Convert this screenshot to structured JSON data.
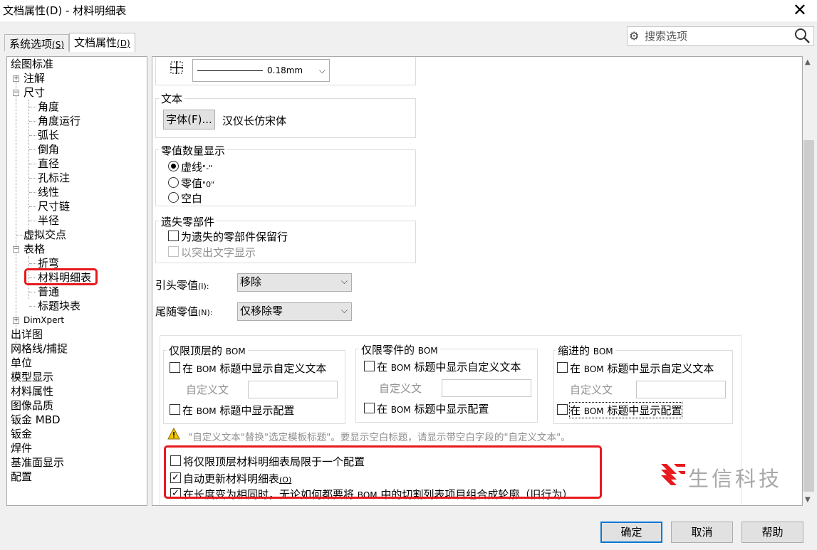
{
  "window": {
    "title": "文档属性(D) - 材料明细表",
    "close": "✕"
  },
  "tabs": [
    {
      "label": "系统选项",
      "accel": "(S)"
    },
    {
      "label": "文档属性",
      "accel": "(D)"
    }
  ],
  "search": {
    "placeholder": "搜索选项"
  },
  "tree": {
    "items": [
      {
        "label": "绘图标准"
      },
      {
        "label": "注解",
        "expander": "+"
      },
      {
        "label": "尺寸",
        "expander": "−"
      },
      {
        "label": "角度"
      },
      {
        "label": "角度运行"
      },
      {
        "label": "弧长"
      },
      {
        "label": "倒角"
      },
      {
        "label": "直径"
      },
      {
        "label": "孔标注"
      },
      {
        "label": "线性"
      },
      {
        "label": "尺寸链"
      },
      {
        "label": "半径"
      },
      {
        "label": "虚拟交点"
      },
      {
        "label": "表格",
        "expander": "−"
      },
      {
        "label": "折弯"
      },
      {
        "label": "材料明细表",
        "selected": true
      },
      {
        "label": "普通"
      },
      {
        "label": "标题块表"
      },
      {
        "label": "DimXpert",
        "expander": "+"
      },
      {
        "label": "出详图"
      },
      {
        "label": "网格线/捕捉"
      },
      {
        "label": "单位"
      },
      {
        "label": "模型显示"
      },
      {
        "label": "材料属性"
      },
      {
        "label": "图像品质"
      },
      {
        "label": "钣金 MBD"
      },
      {
        "label": "钣金"
      },
      {
        "label": "焊件"
      },
      {
        "label": "基准面显示"
      },
      {
        "label": "配置"
      }
    ]
  },
  "border": {
    "thickness": "0.18mm"
  },
  "text_group": {
    "title": "文本",
    "font_button": "字体(F)...",
    "font_name": "汉仪长仿宋体"
  },
  "zero_group": {
    "title": "零值数量显示",
    "options": [
      {
        "label": "虚线",
        "suffix": "\"-\"",
        "selected": true
      },
      {
        "label": "零值",
        "suffix": "\"0\"",
        "selected": false
      },
      {
        "label": "空白",
        "suffix": "",
        "selected": false
      }
    ]
  },
  "missing_group": {
    "title": "遗失零部件",
    "options": [
      {
        "label": "为遗失的零部件保留行",
        "checked": false,
        "enabled": true
      },
      {
        "label": "以突出文字显示",
        "checked": false,
        "enabled": false
      }
    ]
  },
  "leading_zeros": {
    "label": "引头零值",
    "accel": "(I):",
    "value": "移除"
  },
  "trailing_zeros": {
    "label": "尾随零值",
    "accel": "(N):",
    "value": "仅移除零"
  },
  "bom_groups": [
    {
      "title_main": "仅限顶层的",
      "title_suffix": "BOM",
      "opt1_prefix": "在",
      "opt1_mid": "BOM",
      "opt1_rest": "标题中显示自定义文本",
      "custom_label": "自定义文",
      "opt2_prefix": "在",
      "opt2_mid": "BOM",
      "opt2_rest": "标题中显示配置"
    },
    {
      "title_main": "仅限零件的",
      "title_suffix": "BOM",
      "opt1_prefix": "在",
      "opt1_mid": "BOM",
      "opt1_rest": "标题中显示自定义文本",
      "custom_label": "自定义文",
      "opt2_prefix": "在",
      "opt2_mid": "BOM",
      "opt2_rest": "标题中显示配置"
    },
    {
      "title_main": "缩进的",
      "title_suffix": "BOM",
      "opt1_prefix": "在",
      "opt1_mid": "BOM",
      "opt1_rest": "标题中显示自定义文本",
      "custom_label": "自定义文",
      "opt2_prefix": "在",
      "opt2_mid": "BOM",
      "opt2_rest": "标题中显示配置"
    }
  ],
  "warning": "\"自定义文本\"替换\"选定模板标题\"。要显示空白标题，请显示带空白字段的\"自定义文本\"。",
  "bottom_options": [
    {
      "text_a": "将仅限顶层材料明细表局限于一个配置",
      "checked": false
    },
    {
      "text_a": "自动更新材料明细表",
      "accel": "(O)",
      "checked": true
    },
    {
      "text_a": "在长度变为相同时，无论如何都要将",
      "mid": "BOM",
      "text_b": "中的切割列表项目组合成轮廓（旧行为）",
      "checked": true
    }
  ],
  "watermark": {
    "text": "生信科技"
  },
  "buttons": {
    "ok": "确定",
    "cancel": "取消",
    "help": "帮助"
  },
  "colors": {
    "highlight": "#e8191d",
    "accent": "#0078d7"
  }
}
